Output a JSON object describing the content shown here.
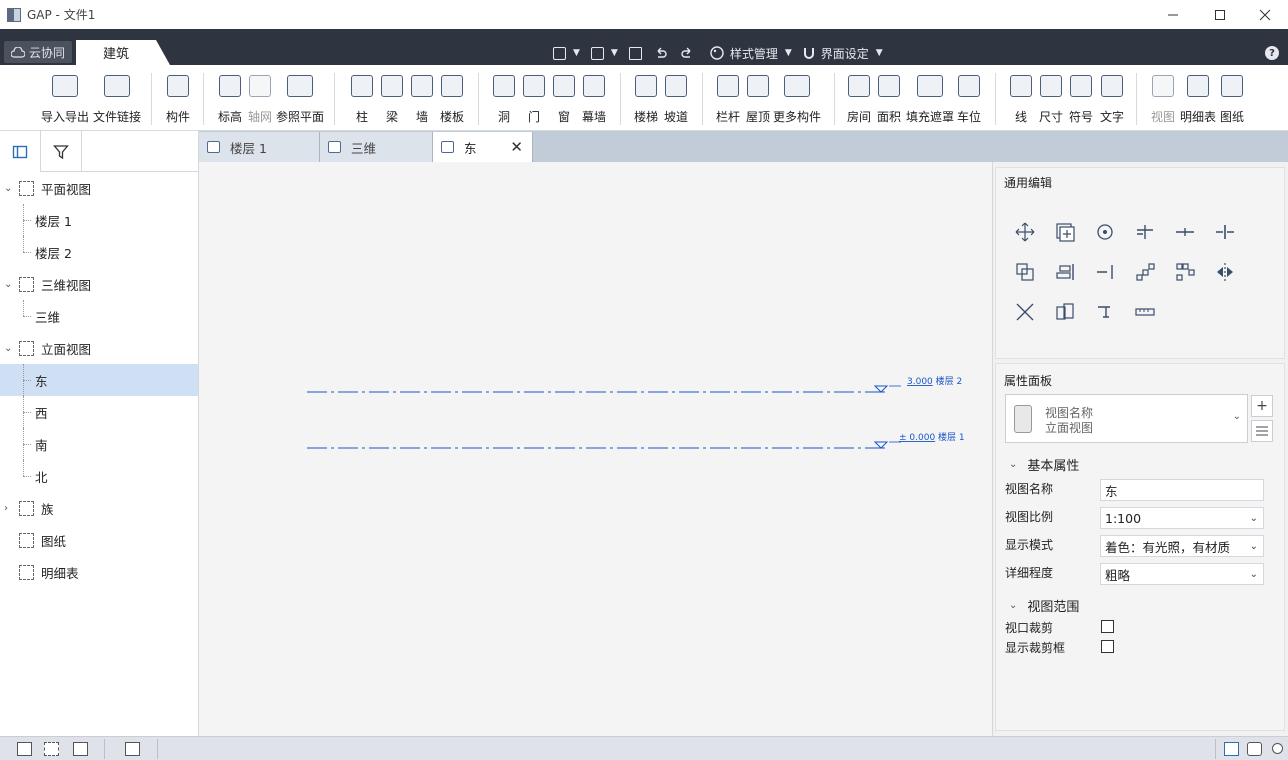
{
  "window": {
    "title": "GAP - 文件1",
    "controls": [
      "minimize",
      "maximize",
      "close"
    ]
  },
  "menubar": {
    "cloud_label": "云协同",
    "active_tab": "建筑",
    "style_label": "样式管理",
    "ui_label": "界面设定",
    "help": "?"
  },
  "ribbon": {
    "groups": [
      {
        "items": [
          {
            "label": "导入导出",
            "icon": "cad-import-icon"
          },
          {
            "label": "文件链接",
            "icon": "file-link-icon"
          }
        ]
      },
      {
        "items": [
          {
            "label": "构件",
            "icon": "component-icon"
          }
        ]
      },
      {
        "items": [
          {
            "label": "标高",
            "icon": "level-icon"
          },
          {
            "label": "轴网",
            "icon": "grid-icon",
            "disabled": true
          },
          {
            "label": "参照平面",
            "icon": "reference-plane-icon"
          }
        ]
      },
      {
        "items": [
          {
            "label": "柱",
            "icon": "column-icon"
          },
          {
            "label": "梁",
            "icon": "beam-icon"
          },
          {
            "label": "墙",
            "icon": "wall-icon"
          },
          {
            "label": "楼板",
            "icon": "floor-icon"
          }
        ]
      },
      {
        "items": [
          {
            "label": "洞",
            "icon": "opening-icon"
          },
          {
            "label": "门",
            "icon": "door-icon"
          },
          {
            "label": "窗",
            "icon": "window-icon"
          },
          {
            "label": "幕墙",
            "icon": "curtain-wall-icon"
          }
        ]
      },
      {
        "items": [
          {
            "label": "楼梯",
            "icon": "stair-icon"
          },
          {
            "label": "坡道",
            "icon": "ramp-icon"
          }
        ]
      },
      {
        "items": [
          {
            "label": "栏杆",
            "icon": "railing-icon"
          },
          {
            "label": "屋顶",
            "icon": "roof-icon"
          },
          {
            "label": "更多构件",
            "icon": "more-components-icon"
          }
        ]
      },
      {
        "items": [
          {
            "label": "房间",
            "icon": "room-icon"
          },
          {
            "label": "面积",
            "icon": "area-icon"
          },
          {
            "label": "填充遮罩",
            "icon": "fill-mask-icon"
          },
          {
            "label": "车位",
            "icon": "parking-icon"
          }
        ]
      },
      {
        "items": [
          {
            "label": "线",
            "icon": "line-icon"
          },
          {
            "label": "尺寸",
            "icon": "dimension-icon"
          },
          {
            "label": "符号",
            "icon": "symbol-icon"
          },
          {
            "label": "文字",
            "icon": "text-icon"
          }
        ]
      },
      {
        "items": [
          {
            "label": "视图",
            "icon": "view-icon",
            "disabled": true
          },
          {
            "label": "明细表",
            "icon": "schedule-icon"
          },
          {
            "label": "图纸",
            "icon": "sheet-icon"
          }
        ]
      }
    ]
  },
  "tree": {
    "items": [
      {
        "label": "平面视图",
        "level": 0,
        "expanded": true
      },
      {
        "label": "楼层 1",
        "level": 1
      },
      {
        "label": "楼层 2",
        "level": 1,
        "last": true
      },
      {
        "label": "三维视图",
        "level": 0,
        "expanded": true
      },
      {
        "label": "三维",
        "level": 1,
        "last": true
      },
      {
        "label": "立面视图",
        "level": 0,
        "expanded": true
      },
      {
        "label": "东",
        "level": 1,
        "selected": true
      },
      {
        "label": "西",
        "level": 1
      },
      {
        "label": "南",
        "level": 1
      },
      {
        "label": "北",
        "level": 1,
        "last": true
      },
      {
        "label": "族",
        "level": 0,
        "expanded": false
      },
      {
        "label": "图纸",
        "level": 0
      },
      {
        "label": "明细表",
        "level": 0
      }
    ]
  },
  "doc_tabs": [
    {
      "label": "楼层 1",
      "active": false
    },
    {
      "label": "三维",
      "active": false
    },
    {
      "label": "东",
      "active": true
    }
  ],
  "canvas": {
    "levels": [
      {
        "value": "3.000",
        "name": "楼层 2"
      },
      {
        "value": "± 0.000",
        "name": "楼层 1"
      }
    ]
  },
  "edit_panel": {
    "title": "通用编辑",
    "tools": [
      "move-icon",
      "copy-icon",
      "rotate-icon",
      "trim-extend-icon",
      "split-icon",
      "split-gap-icon",
      "offset-icon",
      "align-icon",
      "extend-icon",
      "array-icon",
      "pattern-icon",
      "mirror-icon",
      "delete-icon",
      "group-icon",
      "pin-icon",
      "measure-icon"
    ]
  },
  "props": {
    "title": "属性面板",
    "type_name": "视图名称",
    "type_value": "立面视图",
    "basic_section": "基本属性",
    "rows": [
      {
        "label": "视图名称",
        "value": "东",
        "dropdown": false
      },
      {
        "label": "视图比例",
        "value": "1:100",
        "dropdown": true
      },
      {
        "label": "显示模式",
        "value": "着色：有光照，有材质",
        "dropdown": true
      },
      {
        "label": "详细程度",
        "value": "粗略",
        "dropdown": true
      }
    ],
    "range_section": "视图范围",
    "checks": [
      {
        "label": "视口裁剪",
        "checked": false
      },
      {
        "label": "显示裁剪框",
        "checked": false
      }
    ]
  },
  "colors": {
    "accent": "#2f3540",
    "selection": "#cfe0f5",
    "level_line": "#1b55c9"
  }
}
